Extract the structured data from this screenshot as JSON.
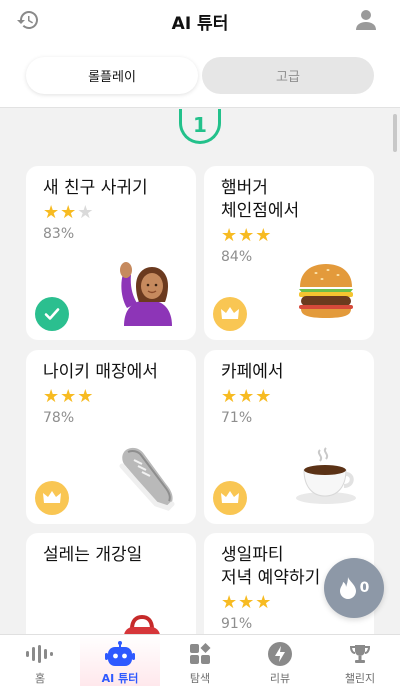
{
  "header": {
    "title": "AI 튜터",
    "history_icon": "history-icon",
    "profile_icon": "profile-icon"
  },
  "segments": {
    "roleplay": "롤플레이",
    "advanced": "고급",
    "selected": "롤플레이"
  },
  "level": {
    "number": "1"
  },
  "cards": [
    {
      "title": "새 친구 사귀기",
      "stars": 2,
      "max_stars": 3,
      "percent": "83%",
      "status": "completed",
      "art": "woman-raising-hand"
    },
    {
      "title": "햄버거\n체인점에서",
      "stars": 3,
      "max_stars": 3,
      "percent": "84%",
      "status": "crown",
      "art": "hamburger"
    },
    {
      "title": "나이키 매장에서",
      "stars": 3,
      "max_stars": 3,
      "percent": "78%",
      "status": "crown",
      "art": "sneaker"
    },
    {
      "title": "카페에서",
      "stars": 3,
      "max_stars": 3,
      "percent": "71%",
      "status": "crown",
      "art": "coffee-cup"
    },
    {
      "title": "설레는 개강일",
      "stars": 0,
      "max_stars": 3,
      "percent": "",
      "status": "",
      "art": "backpack"
    },
    {
      "title": "생일파티\n저녁 예약하기",
      "stars": 3,
      "max_stars": 3,
      "percent": "91%",
      "status": "",
      "art": ""
    }
  ],
  "streak": {
    "count": "0",
    "icon": "flame-icon"
  },
  "tabs": [
    {
      "label": "홈",
      "icon": "waveform-icon",
      "active": false
    },
    {
      "label": "AI 튜터",
      "icon": "robot-icon",
      "active": true
    },
    {
      "label": "탐색",
      "icon": "grid-icon",
      "active": false
    },
    {
      "label": "리뷰",
      "icon": "lightning-icon",
      "active": false
    },
    {
      "label": "챌린지",
      "icon": "trophy-icon",
      "active": false
    }
  ],
  "colors": {
    "accent_green": "#23c18b",
    "star": "#f7bb22",
    "crown": "#f9c653",
    "tab_active": "#2e59ff",
    "fab": "#8d98a7"
  }
}
